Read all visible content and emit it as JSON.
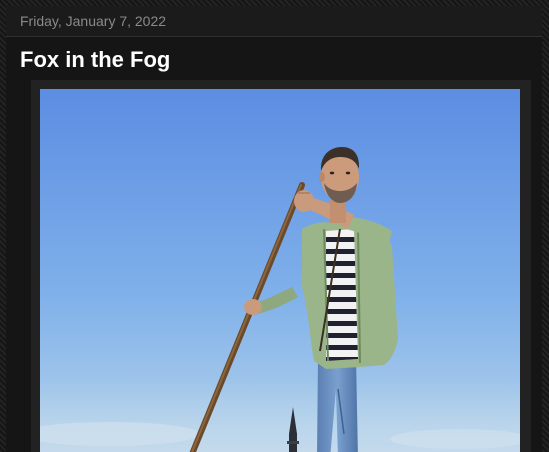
{
  "post": {
    "date": "Friday, January 7, 2022",
    "title": "Fox in the Fog"
  },
  "photo": {
    "subject": "man-poling-gondola-icon"
  },
  "colors": {
    "background": "#151515",
    "date_text": "#8a8a8a",
    "title_text": "#ffffff",
    "sky_top": "#5f8fe0",
    "sky_bottom": "#a9cce8"
  }
}
